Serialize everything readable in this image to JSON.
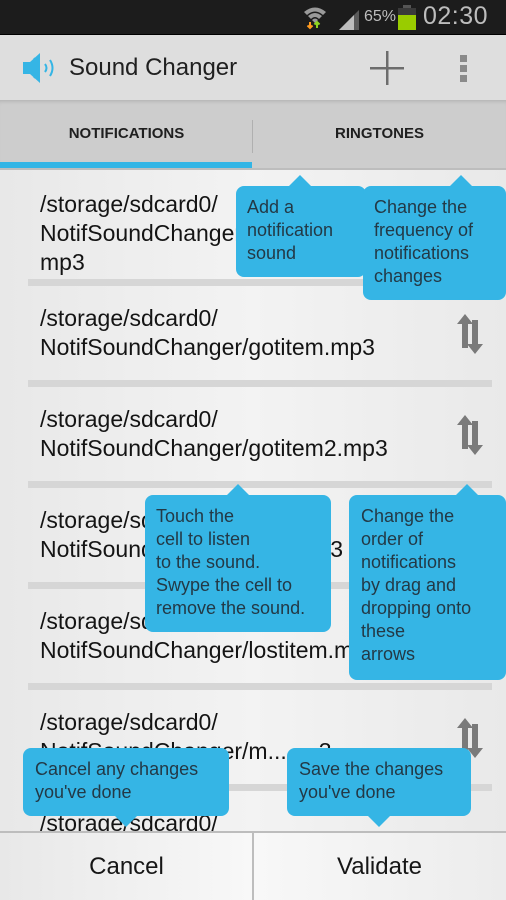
{
  "status_bar": {
    "wifi_icon": "wifi-data-activity-icon",
    "signal_icon": "cell-signal-icon",
    "battery_percent": "65%",
    "battery_level": 0.65,
    "time": "02:30"
  },
  "action_bar": {
    "app_icon": "speaker-sound-icon",
    "title": "Sound Changer",
    "add_icon": "plus-icon",
    "overflow_icon": "overflow-menu-icon"
  },
  "tabs": [
    {
      "label": "NOTIFICATIONS",
      "selected": true
    },
    {
      "label": "RINGTONES",
      "selected": false
    }
  ],
  "sounds": [
    {
      "path": "/storage/sdcard0/\nNotifSoundChanger/gotitem3.\nmp3",
      "visible_text": "/storage/sdcard0/ NotifSoundChang... mp3"
    },
    {
      "path": "/storage/sdcard0/\nNotifSoundChanger/gotitem.mp3"
    },
    {
      "path": "/storage/sdcard0/\nNotifSoundChanger/gotitem2.mp3"
    },
    {
      "path": "/storage/sdcard0/\nNotifSoundChanger/item.mp3",
      "visible_text": "/storage/... NotifSou...m"
    },
    {
      "path": "/storage/sdcard0/\nNotifSoundChanger/lostitem.mp3",
      "visible_text": "/storage/... NotifSoundChanger/lostiten"
    },
    {
      "path": "/storage/sdcard0/\nNotifSoundChanger/m........3",
      "visible_text": "/storage/sdcard0/ NotifSoundChanger/m...3"
    },
    {
      "path": "/storage/sdcard0/",
      "visible_text": "partially hidden"
    }
  ],
  "drag_handle_icon": "reorder-arrows-icon",
  "tooltips": {
    "add_sound": "Add a\nnotification\nsound",
    "frequency": "Change the\nfrequency of\nnotifications\nchanges",
    "touch_cell": "Touch the\ncell to listen\nto the sound.\nSwype the cell to\nremove the sound.",
    "reorder": "Change the\norder of\nnotifications\nby drag and\ndropping onto\nthese\narrows",
    "cancel_hint": "Cancel any changes\nyou've done",
    "save_hint": "Save the changes\nyou've done"
  },
  "bottom_bar": {
    "cancel_label": "Cancel",
    "validate_label": "Validate"
  },
  "colors": {
    "accent": "#33b5e5",
    "tooltip_bg": "#35b5e5",
    "battery": "#99cc00",
    "status_bar_bg": "#1c1c1c",
    "action_bar_bg": "#dedede",
    "tab_bar_bg": "#cdcdcd"
  }
}
